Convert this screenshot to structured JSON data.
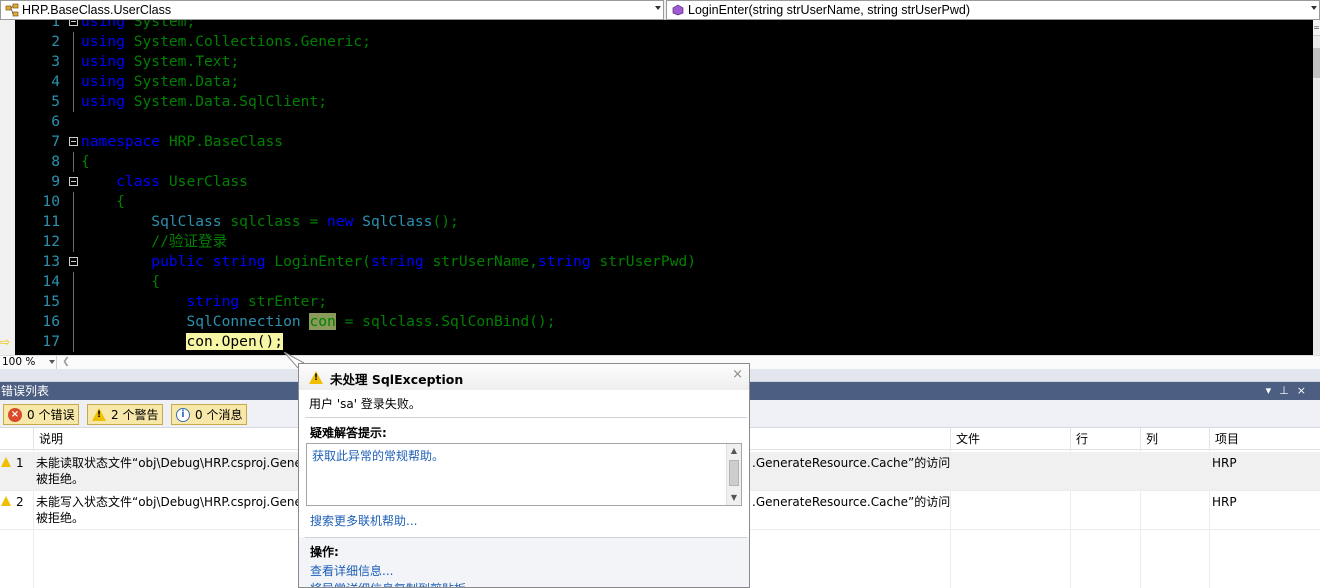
{
  "navbar": {
    "type_dropdown": "HRP.BaseClass.UserClass",
    "member_dropdown": "LoginEnter(string strUserName, string strUserPwd)",
    "type_icon": "class-icon",
    "member_icon": "method-icon"
  },
  "editor": {
    "line_numbers": [
      "1",
      "2",
      "3",
      "4",
      "5",
      "6",
      "7",
      "8",
      "9",
      "10",
      "11",
      "12",
      "13",
      "14",
      "15",
      "16",
      "17"
    ],
    "lines": [
      "using System;",
      "using System.Collections.Generic;",
      "using System.Text;",
      "using System.Data;",
      "using System.Data.SqlClient;",
      "",
      "namespace HRP.BaseClass",
      "{",
      "    class UserClass",
      "    {",
      "        SqlClass sqlclass = new SqlClass();",
      "        //验证登录",
      "        public string LoginEnter(string strUserName,string strUserPwd)",
      "        {",
      "            string strEnter;",
      "            SqlConnection con = sqlclass.SqlConBind();",
      "            con.Open();"
    ],
    "zoom": "100 %"
  },
  "error_list": {
    "title": "错误列表",
    "filters": {
      "errors": "0 个错误",
      "warnings": "2 个警告",
      "messages": "0 个消息"
    },
    "columns": {
      "description": "说明",
      "file": "文件",
      "line": "行",
      "column": "列",
      "project": "项目"
    },
    "rows": [
      {
        "index": "1",
        "description_line1": "未能读取状态文件“obj\\Debug\\HRP.csproj.Gene",
        "description_line1_tail": ".GenerateResource.Cache”的访问",
        "description_line2": "被拒绝。",
        "project": "HRP"
      },
      {
        "index": "2",
        "description_line1": "未能写入状态文件“obj\\Debug\\HRP.csproj.Gene",
        "description_line1_tail": ".GenerateResource.Cache”的访问",
        "description_line2": "被拒绝。",
        "project": "HRP"
      }
    ]
  },
  "exception": {
    "title": "未处理 SqlException",
    "message": "用户 'sa' 登录失败。",
    "troubleshooting_heading": "疑难解答提示:",
    "troubleshooting_tip": "获取此异常的常规帮助。",
    "online_help_link": "搜索更多联机帮助...",
    "actions_heading": "操作:",
    "actions": [
      "查看详细信息...",
      "将异常详细信息复制到剪贴板"
    ],
    "close_glyph": "×"
  }
}
